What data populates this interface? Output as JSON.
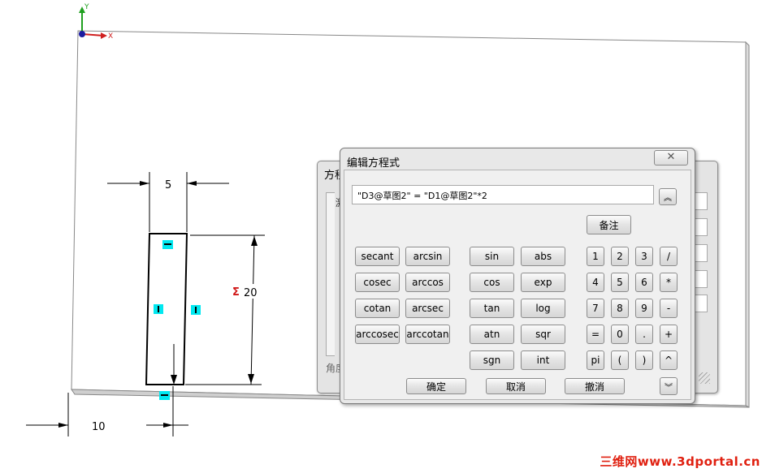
{
  "sketch": {
    "axes": {
      "x_label": "X",
      "y_label": "Y"
    },
    "dimensions": {
      "top": "5",
      "right": "20",
      "bottom": "10"
    },
    "dimension_symbol": "Σ"
  },
  "back_dialog": {
    "title": "方程",
    "label_partial": "激",
    "label_bottom": "角度"
  },
  "dialog": {
    "title": "编辑方程式",
    "close_symbol": "✕",
    "expression": "\"D3@草图2\" = \"D1@草图2\"*2",
    "collapse_up_symbol": "︽",
    "notes_button": "备注",
    "functions": [
      [
        "secant",
        "arcsin"
      ],
      [
        "cosec",
        "arccos"
      ],
      [
        "cotan",
        "arcsec"
      ],
      [
        "arccosec",
        "arccotan"
      ]
    ],
    "math": [
      [
        "sin",
        "abs"
      ],
      [
        "cos",
        "exp"
      ],
      [
        "tan",
        "log"
      ],
      [
        "atn",
        "sqr"
      ],
      [
        "sgn",
        "int"
      ]
    ],
    "keypad": [
      [
        "1",
        "2",
        "3",
        "/"
      ],
      [
        "4",
        "5",
        "6",
        "*"
      ],
      [
        "7",
        "8",
        "9",
        "-"
      ],
      [
        "=",
        "0",
        ".",
        "+"
      ],
      [
        "pi",
        "(",
        ")",
        "^"
      ]
    ],
    "ok_button": "确定",
    "cancel_button": "取消",
    "undo_button": "撤消",
    "collapse_down_symbol": "︾"
  },
  "watermark": "三维网www.3dportal.cn",
  "colors": {
    "axis_x": "#d02020",
    "axis_y": "#20a020",
    "dim_sigma": "#d01818",
    "relation_marker": "#00e8f0"
  }
}
